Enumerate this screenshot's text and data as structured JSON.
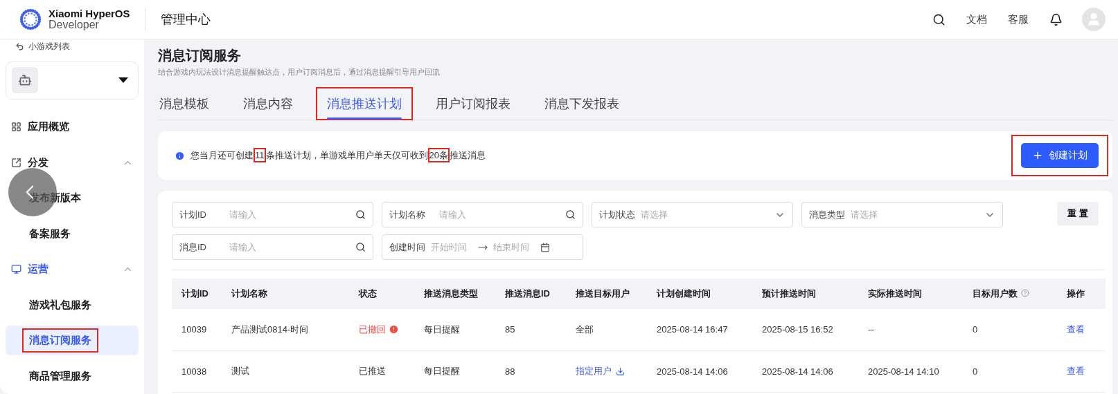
{
  "header": {
    "logo_line1": "Xiaomi HyperOS",
    "logo_line2": "Developer",
    "title": "管理中心",
    "links": [
      "文档",
      "客服"
    ]
  },
  "sidebar": {
    "back": "小游戏列表",
    "items": [
      {
        "label": "应用概览",
        "kind": "item",
        "selected": false
      },
      {
        "label": "分发",
        "kind": "group",
        "expanded": true,
        "active": false,
        "children": [
          {
            "label": "发布新版本",
            "selected": false,
            "annotated": false
          },
          {
            "label": "备案服务",
            "selected": false,
            "annotated": false
          }
        ]
      },
      {
        "label": "运营",
        "kind": "group",
        "expanded": true,
        "active": true,
        "children": [
          {
            "label": "游戏礼包服务",
            "selected": false,
            "annotated": false
          },
          {
            "label": "消息订阅服务",
            "selected": true,
            "annotated": true
          },
          {
            "label": "商品管理服务",
            "selected": false,
            "annotated": false
          }
        ]
      }
    ]
  },
  "page": {
    "title": "消息订阅服务",
    "subtitle": "结合游戏内玩法设计消息提醒触达点，用户订阅消息后，通过消息提醒引导用户回流"
  },
  "tabs": [
    {
      "label": "消息模板",
      "selected": false,
      "annotated": false
    },
    {
      "label": "消息内容",
      "selected": false,
      "annotated": false
    },
    {
      "label": "消息推送计划",
      "selected": true,
      "annotated": true
    },
    {
      "label": "用户订阅报表",
      "selected": false,
      "annotated": false
    },
    {
      "label": "消息下发报表",
      "selected": false,
      "annotated": false
    }
  ],
  "notice": {
    "segments": [
      {
        "text": "您当月还可创建",
        "annotated": false
      },
      {
        "text": "11",
        "annotated": true
      },
      {
        "text": "条推送计划，单游戏单用户单天仅可收到",
        "annotated": false
      },
      {
        "text": "20条",
        "annotated": true
      },
      {
        "text": "推送消息",
        "annotated": false
      }
    ],
    "button": {
      "label": "创建计划",
      "annotated": true
    }
  },
  "filters": [
    {
      "label": "计划ID",
      "placeholder": "请输入",
      "kind": "search"
    },
    {
      "label": "计划名称",
      "placeholder": "请输入",
      "kind": "search"
    },
    {
      "label": "计划状态",
      "placeholder": "请选择",
      "kind": "select"
    },
    {
      "label": "消息类型",
      "placeholder": "请选择",
      "kind": "select"
    },
    {
      "label": "消息ID",
      "placeholder": "请输入",
      "kind": "search"
    },
    {
      "label": "创建时间",
      "placeholder": "开始时间",
      "placeholder_end": "结束时间",
      "kind": "range"
    }
  ],
  "reset_button": "重 置",
  "table": {
    "columns": [
      "计划ID",
      "计划名称",
      "状态",
      "推送消息类型",
      "推送消息ID",
      "推送目标用户",
      "计划创建时间",
      "预计推送时间",
      "实际推送时间",
      "目标用户数",
      "操作"
    ],
    "rows": [
      {
        "id": "10039",
        "name": "产品测试0814-时间",
        "status": {
          "text": "已撤回",
          "kind": "revoked"
        },
        "type": "每日提醒",
        "message_id": "85",
        "target": {
          "text": "全部",
          "kind": "plain"
        },
        "created": "2025-08-14 16:47",
        "planned": "2025-08-15 16:52",
        "actual": "--",
        "users": "0",
        "action": "查看"
      },
      {
        "id": "10038",
        "name": "测试",
        "status": {
          "text": "已推送",
          "kind": "sent"
        },
        "type": "每日提醒",
        "message_id": "88",
        "target": {
          "text": "指定用户",
          "kind": "download"
        },
        "created": "2025-08-14 14:06",
        "planned": "2025-08-14 14:06",
        "actual": "2025-08-14 14:10",
        "users": "0",
        "action": "查看"
      }
    ]
  }
}
